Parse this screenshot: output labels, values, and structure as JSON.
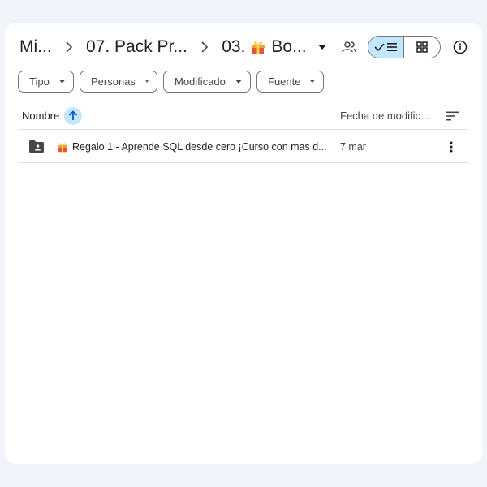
{
  "breadcrumb": {
    "items": [
      {
        "label": "Mi..."
      },
      {
        "label": "07. Pack Pr..."
      }
    ],
    "current": {
      "prefix": "03.",
      "suffix": "Bo..."
    }
  },
  "filters": [
    {
      "label": "Tipo"
    },
    {
      "label": "Personas"
    },
    {
      "label": "Modificado"
    },
    {
      "label": "Fuente"
    }
  ],
  "columns": {
    "name": "Nombre",
    "date": "Fecha de modific..."
  },
  "rows": [
    {
      "name": "Regalo 1 - Aprende SQL desde cero ¡Curso con mas d...",
      "date": "7 mar"
    }
  ],
  "colors": {
    "accent": "#c2e7ff",
    "accent_icon": "#0b57d0",
    "text": "#1f1f1f",
    "muted": "#444746",
    "border": "#747775",
    "background": "#f1f4f9"
  },
  "icons": {
    "breadcrumb_separator": "chevron-right-icon",
    "gift": "gift-emoji-icon",
    "dropdown": "caret-down-icon",
    "share": "people-icon",
    "list_view": "check-list-icon",
    "grid_view": "grid-icon",
    "info": "info-icon",
    "sort_asc": "arrow-up-icon",
    "sort_options": "sort-lines-icon",
    "folder": "shared-folder-icon",
    "more": "more-vert-icon"
  }
}
